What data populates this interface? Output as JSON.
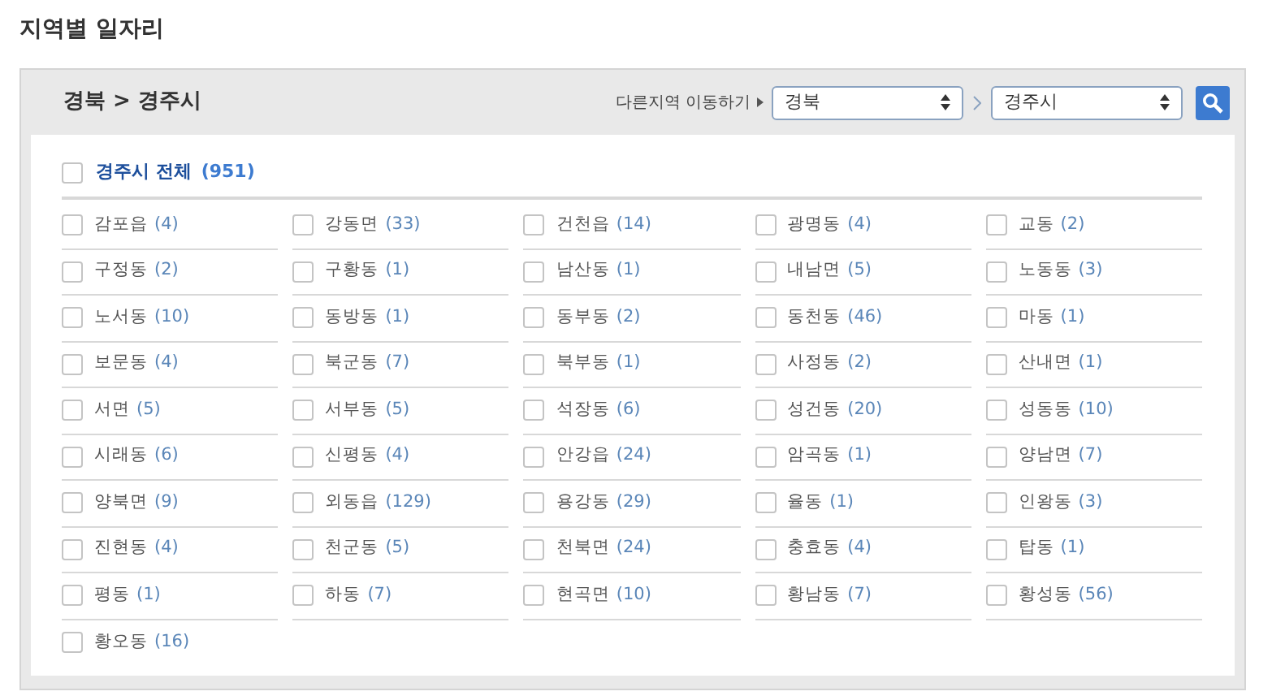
{
  "page_title": "지역별 일자리",
  "header": {
    "breadcrumb": "경북 > 경주시",
    "move_label": "다른지역 이동하기",
    "province_select": {
      "value": "경북"
    },
    "city_select": {
      "value": "경주시"
    }
  },
  "all_option": {
    "label": "경주시 전체",
    "count": "(951)",
    "checked": false
  },
  "areas": [
    {
      "name": "감포읍",
      "count": "(4)",
      "checked": false
    },
    {
      "name": "강동면",
      "count": "(33)",
      "checked": false
    },
    {
      "name": "건천읍",
      "count": "(14)",
      "checked": false
    },
    {
      "name": "광명동",
      "count": "(4)",
      "checked": false
    },
    {
      "name": "교동",
      "count": "(2)",
      "checked": false
    },
    {
      "name": "구정동",
      "count": "(2)",
      "checked": false
    },
    {
      "name": "구황동",
      "count": "(1)",
      "checked": false
    },
    {
      "name": "남산동",
      "count": "(1)",
      "checked": false
    },
    {
      "name": "내남면",
      "count": "(5)",
      "checked": false
    },
    {
      "name": "노동동",
      "count": "(3)",
      "checked": false
    },
    {
      "name": "노서동",
      "count": "(10)",
      "checked": false
    },
    {
      "name": "동방동",
      "count": "(1)",
      "checked": false
    },
    {
      "name": "동부동",
      "count": "(2)",
      "checked": false
    },
    {
      "name": "동천동",
      "count": "(46)",
      "checked": false
    },
    {
      "name": "마동",
      "count": "(1)",
      "checked": false
    },
    {
      "name": "보문동",
      "count": "(4)",
      "checked": false
    },
    {
      "name": "북군동",
      "count": "(7)",
      "checked": false
    },
    {
      "name": "북부동",
      "count": "(1)",
      "checked": false
    },
    {
      "name": "사정동",
      "count": "(2)",
      "checked": false
    },
    {
      "name": "산내면",
      "count": "(1)",
      "checked": false
    },
    {
      "name": "서면",
      "count": "(5)",
      "checked": false
    },
    {
      "name": "서부동",
      "count": "(5)",
      "checked": false
    },
    {
      "name": "석장동",
      "count": "(6)",
      "checked": false
    },
    {
      "name": "성건동",
      "count": "(20)",
      "checked": false
    },
    {
      "name": "성동동",
      "count": "(10)",
      "checked": false
    },
    {
      "name": "시래동",
      "count": "(6)",
      "checked": false
    },
    {
      "name": "신평동",
      "count": "(4)",
      "checked": false
    },
    {
      "name": "안강읍",
      "count": "(24)",
      "checked": false
    },
    {
      "name": "암곡동",
      "count": "(1)",
      "checked": false
    },
    {
      "name": "양남면",
      "count": "(7)",
      "checked": false
    },
    {
      "name": "양북면",
      "count": "(9)",
      "checked": false
    },
    {
      "name": "외동읍",
      "count": "(129)",
      "checked": false
    },
    {
      "name": "용강동",
      "count": "(29)",
      "checked": false
    },
    {
      "name": "율동",
      "count": "(1)",
      "checked": false
    },
    {
      "name": "인왕동",
      "count": "(3)",
      "checked": false
    },
    {
      "name": "진현동",
      "count": "(4)",
      "checked": false
    },
    {
      "name": "천군동",
      "count": "(5)",
      "checked": false
    },
    {
      "name": "천북면",
      "count": "(24)",
      "checked": false
    },
    {
      "name": "충효동",
      "count": "(4)",
      "checked": false
    },
    {
      "name": "탑동",
      "count": "(1)",
      "checked": false
    },
    {
      "name": "평동",
      "count": "(1)",
      "checked": false
    },
    {
      "name": "하동",
      "count": "(7)",
      "checked": false
    },
    {
      "name": "현곡면",
      "count": "(10)",
      "checked": false
    },
    {
      "name": "황남동",
      "count": "(7)",
      "checked": false
    },
    {
      "name": "황성동",
      "count": "(56)",
      "checked": false
    },
    {
      "name": "황오동",
      "count": "(16)",
      "checked": false
    }
  ]
}
